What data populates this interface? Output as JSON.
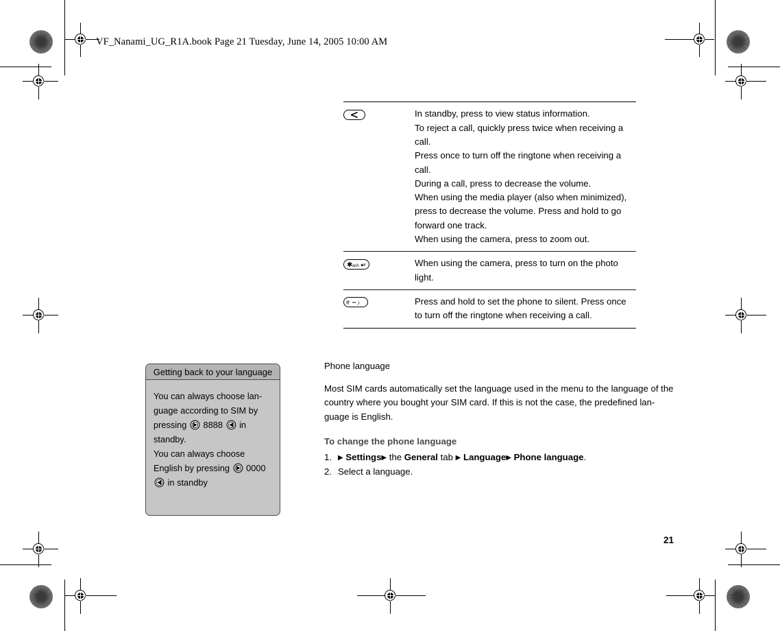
{
  "document": {
    "header_line": "VF_Nanami_UG_R1A.book  Page 21  Tuesday, June 14, 2005  10:00 AM",
    "page_number": "21"
  },
  "key_table": {
    "rows": [
      {
        "key_icon": "volume-down-key-icon",
        "key_glyph": "<",
        "lines": [
          "In standby, press to view status information.",
          "To reject a call, quickly press twice when receiving a call.",
          "Press once to turn off the ringtone when receiving a call.",
          "During a call, press to decrease the volume.",
          "When using the media player (also when minimized), press to decrease the volume. Press and hold to go forward one track.",
          "When using the camera, press to zoom out."
        ]
      },
      {
        "key_icon": "star-key-icon",
        "key_glyph": "*a/A",
        "lines": [
          "When using the camera, press to turn on the photo light."
        ]
      },
      {
        "key_icon": "hash-key-icon",
        "key_glyph": "#",
        "lines": [
          "Press and hold to set the phone to silent. Press once to turn off the ringtone when receiving a call."
        ]
      }
    ]
  },
  "sidebar_tip": {
    "title": "Getting back to your language",
    "body_segments": [
      {
        "type": "text",
        "value": "You can always choose lan-guage according to SIM by pressing "
      },
      {
        "type": "navkey",
        "value": "nav-key-left-icon"
      },
      {
        "type": "text",
        "value": " 8888 "
      },
      {
        "type": "navkey",
        "value": "nav-key-right-icon"
      },
      {
        "type": "text",
        "value": " in standby."
      },
      {
        "type": "break"
      },
      {
        "type": "text",
        "value": "You can always choose English by pressing "
      },
      {
        "type": "navkey",
        "value": "nav-key-left-icon"
      },
      {
        "type": "text",
        "value": " 0000 "
      },
      {
        "type": "navkey",
        "value": "nav-key-right-icon"
      },
      {
        "type": "text",
        "value": " in standby"
      }
    ],
    "plain_text": "You can always choose lan-guage according to SIM by pressing  8888  in standby. You can always choose English by pressing  0000  in standby",
    "codes": [
      "8888",
      "0000"
    ],
    "colors": {
      "header_bg": "#b3b3b3",
      "body_bg": "#c6c6c6",
      "border": "#4c4c4c"
    }
  },
  "body_section": {
    "sub_head": "Phone language",
    "paragraph": "Most SIM cards automatically set the language used in the menu to the language of the country where you bought your SIM card. If this is not the case, the predefined lan-guage is English.",
    "procedure_head": "To change the phone language",
    "steps": [
      {
        "number": "1.",
        "segments": [
          {
            "bold": false,
            "arrow": true,
            "text": ""
          },
          {
            "bold": true,
            "arrow": false,
            "text": "Settings"
          },
          {
            "bold": false,
            "arrow": true,
            "text": ""
          },
          {
            "bold": false,
            "arrow": false,
            "text": "the "
          },
          {
            "bold": true,
            "arrow": false,
            "text": "General"
          },
          {
            "bold": false,
            "arrow": false,
            "text": " tab "
          },
          {
            "bold": false,
            "arrow": true,
            "text": ""
          },
          {
            "bold": true,
            "arrow": false,
            "text": "Language"
          },
          {
            "bold": false,
            "arrow": true,
            "text": ""
          },
          {
            "bold": true,
            "arrow": false,
            "text": "Phone language"
          },
          {
            "bold": false,
            "arrow": false,
            "text": "."
          }
        ],
        "plain": "▶ Settings ▶ the General tab ▶ Language ▶ Phone language."
      },
      {
        "number": "2.",
        "segments": [
          {
            "bold": false,
            "arrow": false,
            "text": "Select a language."
          }
        ],
        "plain": "Select a language."
      }
    ]
  },
  "print_marks": {
    "registration_target_name": "registration-target-icon",
    "rosette_name": "color-rosette-icon",
    "trim_line_name": "trim-line"
  }
}
